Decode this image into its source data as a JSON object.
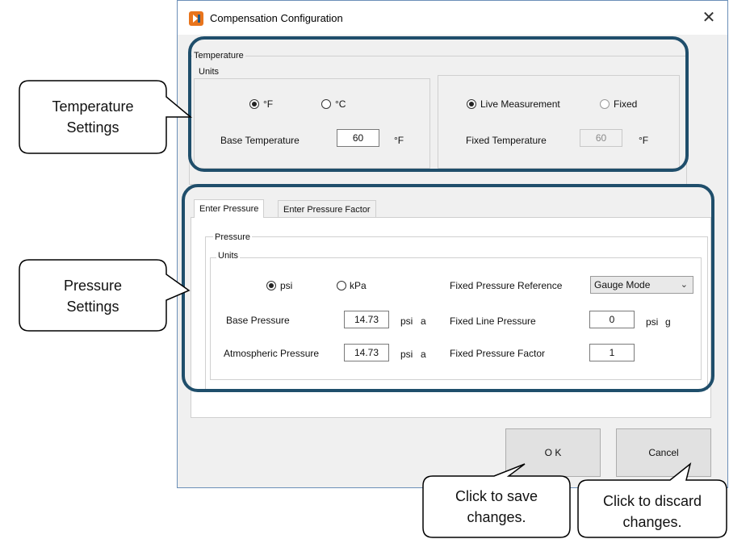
{
  "window": {
    "title": "Compensation Configuration",
    "close_glyph": "✕",
    "app_icon": "app-logo-icon"
  },
  "temperature": {
    "group_label": "Temperature",
    "units_label": "Units",
    "unit_f": "°F",
    "unit_c": "°C",
    "selected_unit": "°F",
    "base_temp_label": "Base Temperature",
    "base_temp_value": "60",
    "base_temp_unit": "°F",
    "live_label": "Live Measurement",
    "fixed_label": "Fixed",
    "selected_mode": "Live Measurement",
    "fixed_temp_label": "Fixed Temperature",
    "fixed_temp_value": "60",
    "fixed_temp_unit": "°F"
  },
  "tabs": [
    {
      "label": "Enter Pressure",
      "active": true
    },
    {
      "label": "Enter Pressure Factor",
      "active": false
    }
  ],
  "pressure": {
    "group_label": "Pressure",
    "units_label": "Units",
    "unit_psi": "psi",
    "unit_kpa": "kPa",
    "selected_unit": "psi",
    "base_pressure_label": "Base Pressure",
    "base_pressure_value": "14.73",
    "base_pressure_unit": "psi",
    "base_pressure_suffix": "a",
    "atm_pressure_label": "Atmospheric Pressure",
    "atm_pressure_value": "14.73",
    "atm_pressure_unit": "psi",
    "atm_pressure_suffix": "a",
    "fixed_ref_label": "Fixed Pressure Reference",
    "fixed_ref_value": "Gauge Mode",
    "fixed_line_label": "Fixed Line Pressure",
    "fixed_line_value": "0",
    "fixed_line_unit": "psi",
    "fixed_line_suffix": "g",
    "fixed_factor_label": "Fixed Pressure Factor",
    "fixed_factor_value": "1"
  },
  "buttons": {
    "ok": "O K",
    "cancel": "Cancel"
  },
  "callouts": {
    "temperature_line1": "Temperature",
    "temperature_line2": "Settings",
    "pressure_line1": "Pressure",
    "pressure_line2": "Settings",
    "save_line1": "Click to save",
    "save_line2": "changes.",
    "discard_line1": "Click to discard",
    "discard_line2": "changes."
  },
  "colors": {
    "highlight": "#1f4e6b",
    "app_icon_orange": "#e8741c",
    "app_icon_blue": "#1e5a8a"
  }
}
